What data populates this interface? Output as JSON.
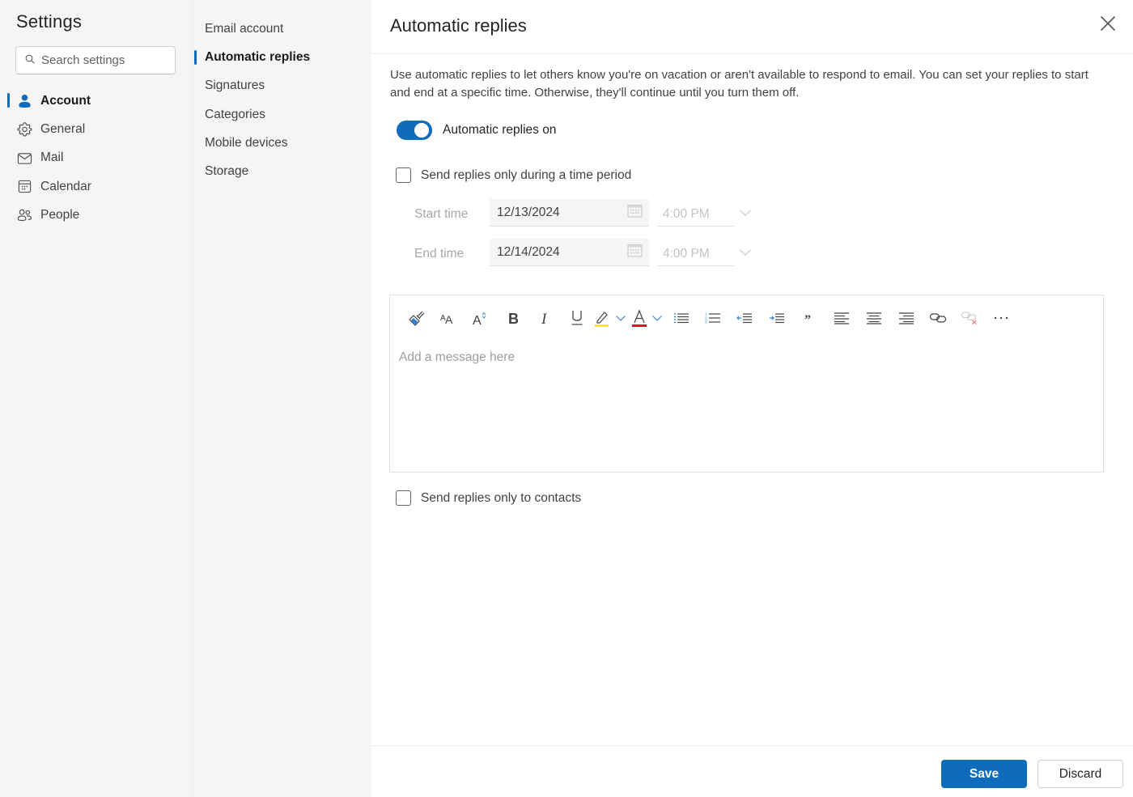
{
  "app": {
    "title": "Settings",
    "search_placeholder": "Search settings"
  },
  "primary_nav": [
    {
      "label": "Account",
      "icon": "person-icon",
      "active": true
    },
    {
      "label": "General",
      "icon": "gear-icon",
      "active": false
    },
    {
      "label": "Mail",
      "icon": "mail-icon",
      "active": false
    },
    {
      "label": "Calendar",
      "icon": "calendar-icon",
      "active": false
    },
    {
      "label": "People",
      "icon": "people-icon",
      "active": false
    }
  ],
  "secondary_nav": [
    {
      "label": "Email account",
      "active": false
    },
    {
      "label": "Automatic replies",
      "active": true
    },
    {
      "label": "Signatures",
      "active": false
    },
    {
      "label": "Categories",
      "active": false
    },
    {
      "label": "Mobile devices",
      "active": false
    },
    {
      "label": "Storage",
      "active": false
    }
  ],
  "main": {
    "title": "Automatic replies",
    "description": "Use automatic replies to let others know you're on vacation or aren't available to respond to email. You can set your replies to start and end at a specific time. Otherwise, they'll continue until you turn them off.",
    "toggle": {
      "label": "Automatic replies on",
      "on": true
    },
    "time_period_checkbox": {
      "label": "Send replies only during a time period",
      "checked": false
    },
    "start": {
      "label": "Start time",
      "date": "12/13/2024",
      "time": "4:00 PM"
    },
    "end": {
      "label": "End time",
      "date": "12/14/2024",
      "time": "4:00 PM"
    },
    "editor": {
      "placeholder": "Add a message here",
      "toolbar": [
        "format-painter",
        "font-size",
        "grow-font",
        "bold",
        "italic",
        "underline",
        "highlight",
        "font-color",
        "bullets",
        "numbering",
        "decrease-indent",
        "increase-indent",
        "quote",
        "align-left",
        "align-center",
        "align-right",
        "insert-link",
        "remove-link",
        "more-options"
      ],
      "highlight_color": "#ffeb00",
      "font_color": "#e81123"
    },
    "contacts_checkbox": {
      "label": "Send replies only to contacts",
      "checked": false
    }
  },
  "footer": {
    "save_label": "Save",
    "discard_label": "Discard"
  },
  "colors": {
    "accent": "#0f6cbd",
    "sidebar_bg": "#f5f5f5"
  }
}
